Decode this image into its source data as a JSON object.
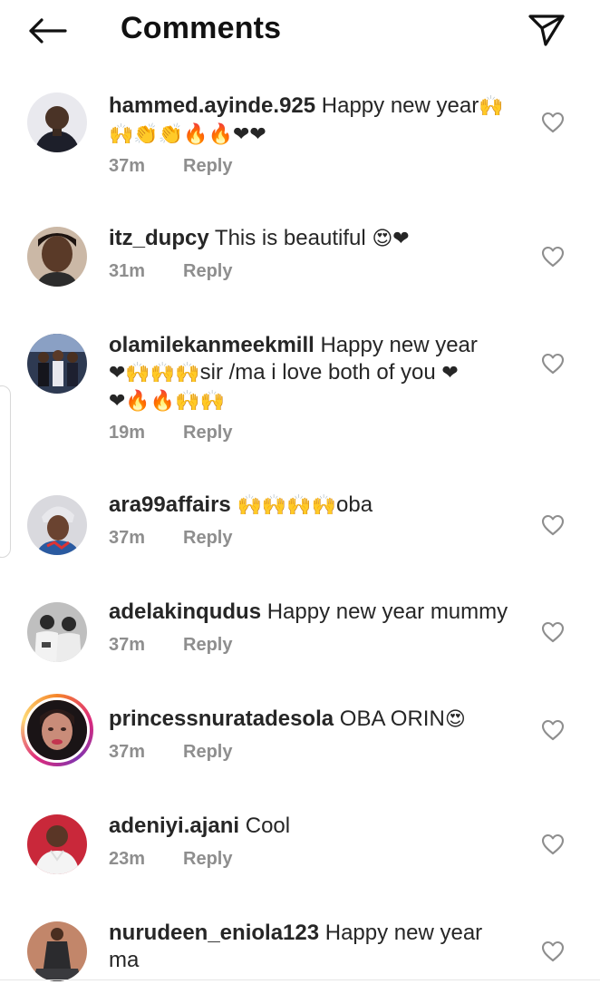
{
  "header": {
    "title": "Comments",
    "back_icon": "arrow-left-icon",
    "send_icon": "paper-plane-icon"
  },
  "reply_label": "Reply",
  "comments": [
    {
      "username": "hammed.ayinde.925",
      "text_lines": [
        "Happy new year🙌",
        "🙌👏👏🔥🔥❤❤"
      ],
      "time": "37m",
      "avatar": "person-dark-jacket",
      "story_ring": false
    },
    {
      "username": "itz_dupcy",
      "text_lines": [
        "This is beautiful 😍❤"
      ],
      "time": "31m",
      "avatar": "woman-portrait",
      "story_ring": false
    },
    {
      "username": "olamilekanmeekmill",
      "text_lines": [
        "Happy new year",
        "❤🙌🙌🙌sir /ma i love both of you ❤",
        "❤🔥🔥🙌🙌"
      ],
      "time": "19m",
      "avatar": "group-photo",
      "story_ring": false
    },
    {
      "username": "ara99affairs",
      "text_lines": [
        "🙌🙌🙌🙌oba"
      ],
      "time": "37m",
      "avatar": "woman-headwrap",
      "story_ring": false
    },
    {
      "username": "adelakinqudus",
      "text_lines": [
        "Happy new year mummy"
      ],
      "time": "37m",
      "avatar": "two-people-bw",
      "story_ring": false
    },
    {
      "username": "princessnuratadesola",
      "text_lines": [
        "OBA ORIN😍"
      ],
      "time": "37m",
      "avatar": "woman-closeup",
      "story_ring": true
    },
    {
      "username": "adeniyi.ajani",
      "text_lines": [
        "Cool"
      ],
      "time": "23m",
      "avatar": "man-red-background",
      "story_ring": false
    },
    {
      "username": "nurudeen_eniola123",
      "text_lines": [
        "Happy new year",
        "ma"
      ],
      "time": "",
      "avatar": "man-standing",
      "story_ring": false
    }
  ]
}
